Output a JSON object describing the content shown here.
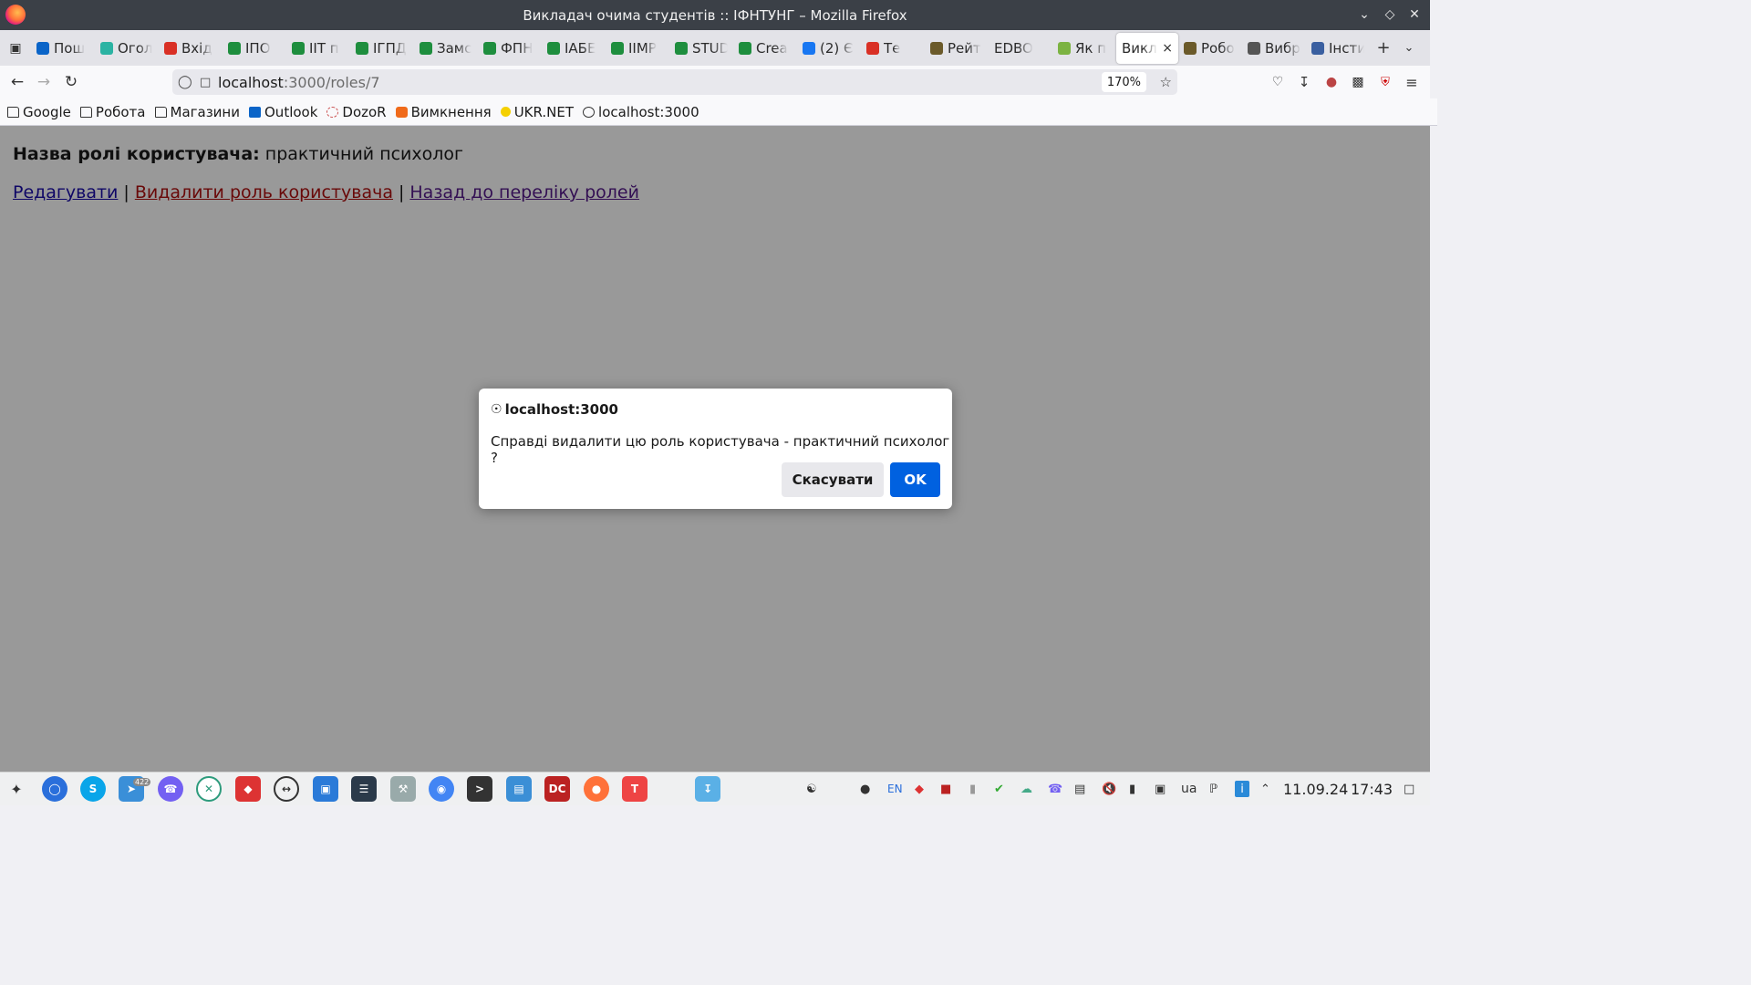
{
  "window": {
    "title": "Викладач очима студентів :: ІФНТУНГ – Mozilla Firefox"
  },
  "tabs": [
    {
      "label": "Пош",
      "icon": "outlook-icon",
      "color": "#0a64c8"
    },
    {
      "label": "Огол",
      "icon": "circle-icon",
      "color": "#2bb3a3"
    },
    {
      "label": "Вхід",
      "icon": "gmail-icon",
      "color": "#d93025"
    },
    {
      "label": "ІПО",
      "icon": "sheets-icon",
      "color": "#1e8e3e"
    },
    {
      "label": "ІІТ п",
      "icon": "sheets-icon",
      "color": "#1e8e3e"
    },
    {
      "label": "ІГПД",
      "icon": "sheets-icon",
      "color": "#1e8e3e"
    },
    {
      "label": "Замс",
      "icon": "sheets-icon",
      "color": "#1e8e3e"
    },
    {
      "label": "ФПН",
      "icon": "sheets-icon",
      "color": "#1e8e3e"
    },
    {
      "label": "ІАБЕ",
      "icon": "sheets-icon",
      "color": "#1e8e3e"
    },
    {
      "label": "ІІМР",
      "icon": "sheets-icon",
      "color": "#1e8e3e"
    },
    {
      "label": "STUD",
      "icon": "sheets-icon",
      "color": "#1e8e3e"
    },
    {
      "label": "Crea",
      "icon": "sheets-icon",
      "color": "#1e8e3e"
    },
    {
      "label": "(2) Є",
      "icon": "facebook-icon",
      "color": "#1877f2"
    },
    {
      "label": "Те",
      "icon": "gmail-icon",
      "color": "#d93025"
    },
    {
      "label": "Рейт",
      "icon": "shield-icon",
      "color": "#6b5a2a"
    },
    {
      "label": "EDBO",
      "icon": "",
      "color": "#e3e3e8"
    },
    {
      "label": "Як п",
      "icon": "android-icon",
      "color": "#7cb342"
    },
    {
      "label": "Викл",
      "icon": "",
      "color": "#ffffff",
      "active": true
    },
    {
      "label": "Робо",
      "icon": "shield-icon",
      "color": "#6b5a2a"
    },
    {
      "label": "Вибр",
      "icon": "key-icon",
      "color": "#555555"
    },
    {
      "label": "Інсти",
      "icon": "emblem-icon",
      "color": "#3a5fa0"
    }
  ],
  "nav": {
    "url_host": "localhost",
    "url_path": ":3000/roles/7",
    "zoom": "170%"
  },
  "bookmarks": [
    {
      "label": "Google",
      "icon": "folder-icon"
    },
    {
      "label": "Робота",
      "icon": "folder-icon"
    },
    {
      "label": "Магазини",
      "icon": "folder-icon"
    },
    {
      "label": "Outlook",
      "icon": "outlook-icon"
    },
    {
      "label": "DozoR",
      "icon": "dozor-icon"
    },
    {
      "label": "Вимкнення",
      "icon": "power-icon"
    },
    {
      "label": "UKR.NET",
      "icon": "ukrnet-icon"
    },
    {
      "label": "localhost:3000",
      "icon": "globe-icon"
    }
  ],
  "page": {
    "role_label": "Назва ролі користувача:",
    "role_value": " практичний психолог",
    "edit_link": "Редагувати",
    "delete_link": "Видалити роль користувача",
    "back_link": "Назад до переліку ролей",
    "separator": "|"
  },
  "dialog": {
    "host": "localhost:3000",
    "message": "Справді видалити цю роль користувача - практичний психолог ?",
    "cancel_label": "Скасувати",
    "ok_label": "OK"
  },
  "taskbar": {
    "badge": "422",
    "tray_lang": "EN",
    "tray_locale": "ua",
    "date": "11.09.24",
    "time": "17:43"
  }
}
